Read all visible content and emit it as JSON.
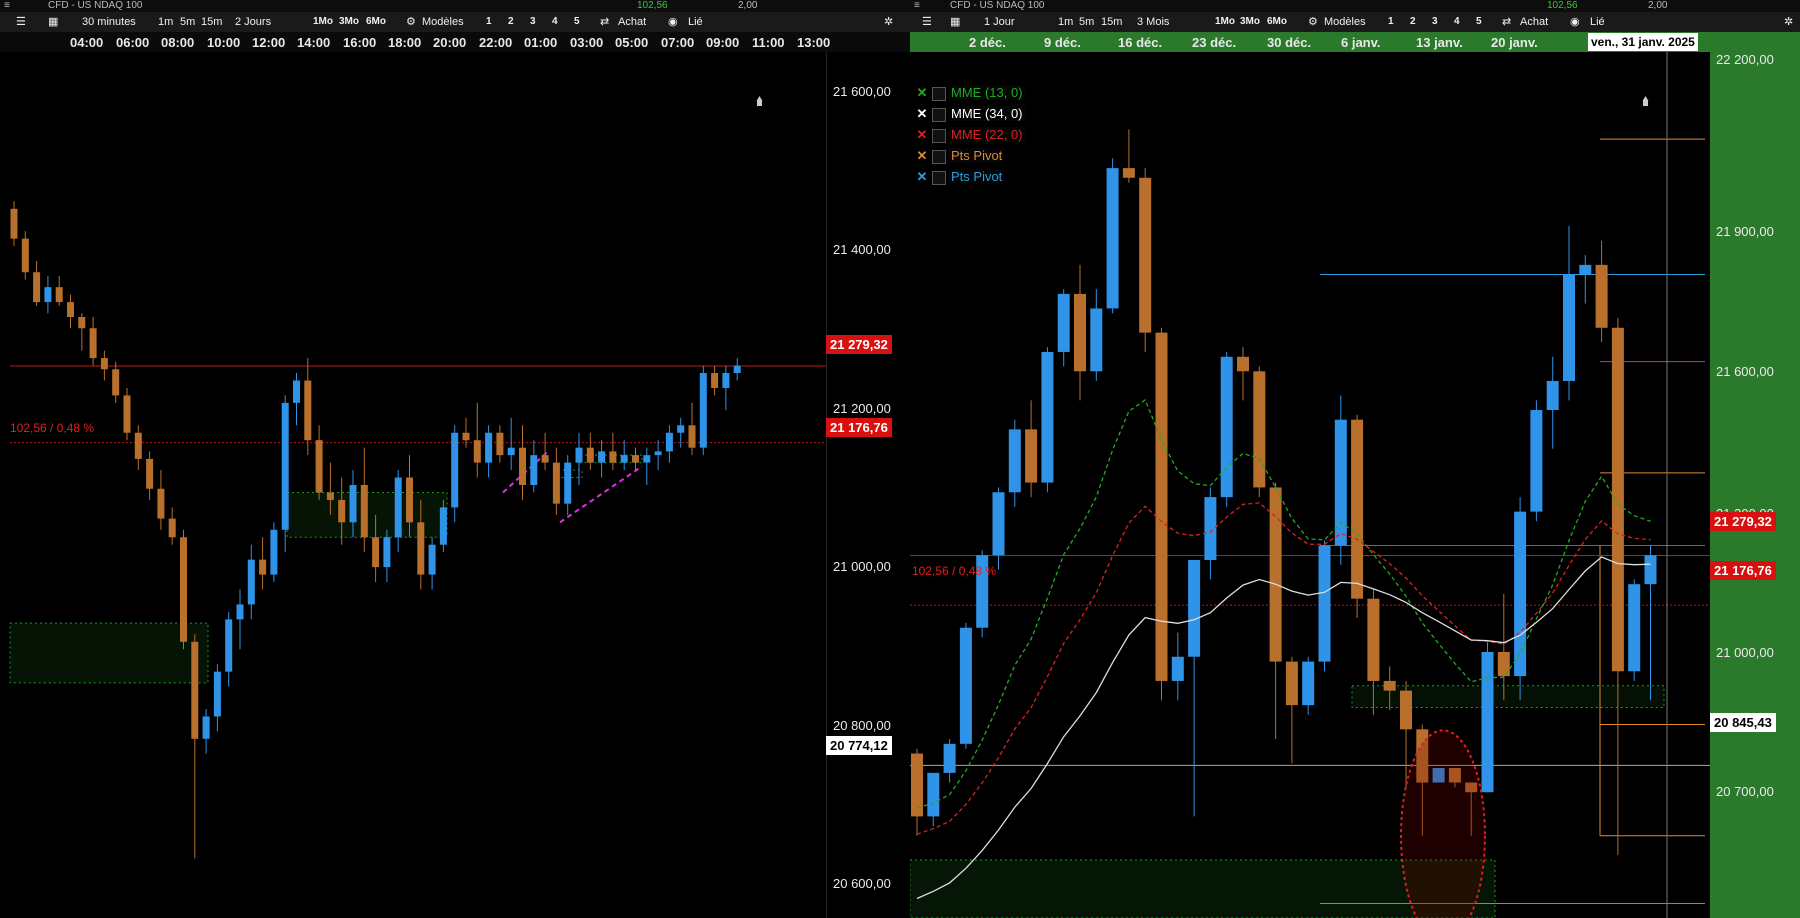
{
  "left": {
    "header": {
      "instrument": "CFD - US NDAQ 100",
      "val1": "102,56",
      "val2": "2,00"
    },
    "toolbar": {
      "interval": "30 minutes",
      "range": "2 Jours",
      "quick": [
        "1m",
        "5m",
        "15m"
      ],
      "periods": [
        "1Mo",
        "3Mo",
        "6Mo"
      ],
      "models": "Modèles",
      "nums": [
        "1",
        "2",
        "3",
        "4",
        "5"
      ],
      "buy": "Achat",
      "linked": "Lié"
    },
    "time_ticks": [
      "04:00",
      "06:00",
      "08:00",
      "10:00",
      "12:00",
      "14:00",
      "16:00",
      "18:00",
      "20:00",
      "22:00",
      "01:00",
      "03:00",
      "05:00",
      "07:00",
      "09:00",
      "11:00",
      "13:00"
    ],
    "price_axis": [
      "21 600,00",
      "21 400,00",
      "21 200,00",
      "21 000,00",
      "20 800,00",
      "20 600,00"
    ],
    "tag_last": "21 279,32",
    "tag_ref": "21 176,76",
    "tag_low": "20 774,12",
    "change_label": "102,56 / 0,48 %"
  },
  "right": {
    "header": {
      "instrument": "CFD - US NDAQ 100",
      "val1": "102,56",
      "val2": "2,00"
    },
    "toolbar": {
      "interval": "1 Jour",
      "range": "3 Mois",
      "quick": [
        "1m",
        "5m",
        "15m"
      ],
      "periods": [
        "1Mo",
        "3Mo",
        "6Mo"
      ],
      "models": "Modèles",
      "nums": [
        "1",
        "2",
        "3",
        "4",
        "5"
      ],
      "buy": "Achat",
      "linked": "Lié"
    },
    "time_ticks": [
      "2 déc.",
      "9 déc.",
      "16 déc.",
      "23 déc.",
      "30 déc.",
      "6 janv.",
      "13 janv.",
      "20 janv."
    ],
    "cursor_date": "ven., 31 janv. 2025",
    "price_axis": [
      "22 200,00",
      "21 900,00",
      "21 600,00",
      "21 300,00",
      "21 000,00",
      "20 700,00"
    ],
    "tag_last": "21 279,32",
    "tag_ref": "21 176,76",
    "tag_cursor": "20 845,43",
    "change_label": "102,56 / 0,48 %",
    "legend": [
      {
        "name": "MME (13, 0)",
        "color": "#22aa22"
      },
      {
        "name": "MME (34, 0)",
        "color": "#ffffff"
      },
      {
        "name": "MME (22, 0)",
        "color": "#e02020"
      },
      {
        "name": "Pts Pivot",
        "color": "#e08a30"
      },
      {
        "name": "Pts Pivot",
        "color": "#2aa0e0"
      }
    ]
  },
  "colors": {
    "up": "#2f93e8",
    "down": "#b8702c",
    "ref_line": "#e02020",
    "green_zone": "#1f9a1f",
    "pink": "#e030e0"
  },
  "chart_data": [
    {
      "type": "candlestick",
      "title": "",
      "interval": "30 minutes",
      "ylim": [
        20540,
        21700
      ],
      "reference_lines": {
        "last": 21279.32,
        "previous_close": 21176.76,
        "low_marker": 20774.12
      },
      "candles": [
        [
          21490,
          21500,
          21440,
          21450
        ],
        [
          21450,
          21460,
          21395,
          21405
        ],
        [
          21405,
          21420,
          21360,
          21365
        ],
        [
          21365,
          21400,
          21350,
          21385
        ],
        [
          21385,
          21400,
          21360,
          21365
        ],
        [
          21365,
          21375,
          21330,
          21345
        ],
        [
          21345,
          21350,
          21300,
          21330
        ],
        [
          21330,
          21345,
          21280,
          21290
        ],
        [
          21290,
          21300,
          21260,
          21275
        ],
        [
          21275,
          21285,
          21230,
          21240
        ],
        [
          21240,
          21250,
          21180,
          21190
        ],
        [
          21190,
          21200,
          21140,
          21155
        ],
        [
          21155,
          21165,
          21100,
          21115
        ],
        [
          21115,
          21140,
          21060,
          21075
        ],
        [
          21075,
          21090,
          21040,
          21050
        ],
        [
          21050,
          21060,
          20900,
          20910
        ],
        [
          20910,
          20920,
          20620,
          20780
        ],
        [
          20780,
          20820,
          20760,
          20810
        ],
        [
          20810,
          20880,
          20790,
          20870
        ],
        [
          20870,
          20950,
          20850,
          20940
        ],
        [
          20940,
          20980,
          20900,
          20960
        ],
        [
          20960,
          21040,
          20940,
          21020
        ],
        [
          21020,
          21050,
          20980,
          21000
        ],
        [
          21000,
          21070,
          20990,
          21060
        ],
        [
          21060,
          21240,
          21030,
          21230
        ],
        [
          21230,
          21270,
          21200,
          21260
        ],
        [
          21260,
          21290,
          21160,
          21180
        ],
        [
          21180,
          21200,
          21100,
          21110
        ],
        [
          21110,
          21150,
          21080,
          21100
        ],
        [
          21100,
          21130,
          21040,
          21070
        ],
        [
          21070,
          21140,
          21050,
          21120
        ],
        [
          21120,
          21170,
          21030,
          21050
        ],
        [
          21050,
          21080,
          20990,
          21010
        ],
        [
          21010,
          21060,
          20990,
          21050
        ],
        [
          21050,
          21140,
          21030,
          21130
        ],
        [
          21130,
          21160,
          21050,
          21070
        ],
        [
          21070,
          21100,
          20980,
          21000
        ],
        [
          21000,
          21050,
          20980,
          21040
        ],
        [
          21040,
          21100,
          21030,
          21090
        ],
        [
          21090,
          21200,
          21070,
          21190
        ],
        [
          21190,
          21210,
          21170,
          21180
        ],
        [
          21180,
          21230,
          21130,
          21150
        ],
        [
          21150,
          21200,
          21130,
          21190
        ],
        [
          21190,
          21200,
          21150,
          21160
        ],
        [
          21160,
          21210,
          21140,
          21170
        ],
        [
          21170,
          21200,
          21100,
          21120
        ],
        [
          21120,
          21180,
          21110,
          21160
        ],
        [
          21160,
          21190,
          21140,
          21150
        ],
        [
          21150,
          21170,
          21080,
          21095
        ],
        [
          21095,
          21160,
          21080,
          21150
        ],
        [
          21150,
          21190,
          21120,
          21170
        ],
        [
          21170,
          21190,
          21140,
          21150
        ],
        [
          21150,
          21180,
          21130,
          21165
        ],
        [
          21165,
          21190,
          21140,
          21150
        ],
        [
          21150,
          21180,
          21140,
          21160
        ],
        [
          21160,
          21170,
          21140,
          21150
        ],
        [
          21150,
          21170,
          21120,
          21160
        ],
        [
          21160,
          21180,
          21140,
          21165
        ],
        [
          21165,
          21200,
          21150,
          21190
        ],
        [
          21190,
          21210,
          21170,
          21200
        ],
        [
          21200,
          21230,
          21160,
          21170
        ],
        [
          21170,
          21280,
          21160,
          21270
        ],
        [
          21270,
          21280,
          21240,
          21250
        ],
        [
          21250,
          21280,
          21220,
          21270
        ],
        [
          21270,
          21290,
          21260,
          21280
        ]
      ]
    },
    {
      "type": "candlestick",
      "title": "",
      "interval": "1 Jour",
      "ylim": [
        20530,
        22320
      ],
      "reference_lines": {
        "last": 21279.32,
        "previous_close": 21176.76,
        "cursor": 20845.43
      },
      "candles": [
        [
          20870,
          20880,
          20700,
          20740
        ],
        [
          20740,
          20830,
          20720,
          20830
        ],
        [
          20830,
          20900,
          20810,
          20890
        ],
        [
          20890,
          21140,
          20880,
          21130
        ],
        [
          21130,
          21290,
          21110,
          21280
        ],
        [
          21280,
          21420,
          21250,
          21410
        ],
        [
          21410,
          21560,
          21380,
          21540
        ],
        [
          21540,
          21600,
          21400,
          21430
        ],
        [
          21430,
          21710,
          21410,
          21700
        ],
        [
          21700,
          21830,
          21670,
          21820
        ],
        [
          21820,
          21880,
          21600,
          21660
        ],
        [
          21660,
          21830,
          21640,
          21790
        ],
        [
          21790,
          22100,
          21780,
          22080
        ],
        [
          22080,
          22160,
          22050,
          22060
        ],
        [
          22060,
          22080,
          21700,
          21740
        ],
        [
          21740,
          21750,
          20980,
          21020
        ],
        [
          21020,
          21120,
          20980,
          21070
        ],
        [
          21070,
          21070,
          20740,
          21270
        ],
        [
          21270,
          21420,
          21230,
          21400
        ],
        [
          21400,
          21700,
          21380,
          21690
        ],
        [
          21690,
          21710,
          21600,
          21660
        ],
        [
          21660,
          21670,
          21400,
          21420
        ],
        [
          21420,
          21430,
          20900,
          21060
        ],
        [
          21060,
          21070,
          20850,
          20970
        ],
        [
          20970,
          21070,
          20950,
          21060
        ],
        [
          21060,
          21310,
          21040,
          21300
        ],
        [
          21300,
          21610,
          21260,
          21560
        ],
        [
          21560,
          21570,
          21150,
          21190
        ],
        [
          21190,
          21210,
          20950,
          21020
        ],
        [
          21020,
          21050,
          20960,
          21000
        ],
        [
          21000,
          21020,
          20800,
          20920
        ],
        [
          20920,
          20930,
          20700,
          20810
        ],
        [
          20810,
          20840,
          20810,
          20840
        ],
        [
          20840,
          20840,
          20800,
          20810
        ],
        [
          20810,
          20810,
          20700,
          20790
        ],
        [
          20790,
          21100,
          20790,
          21080
        ],
        [
          21080,
          21200,
          20980,
          21030
        ],
        [
          21030,
          21400,
          20980,
          21370
        ],
        [
          21370,
          21600,
          21350,
          21580
        ],
        [
          21580,
          21690,
          21500,
          21640
        ],
        [
          21640,
          21960,
          21600,
          21860
        ],
        [
          21860,
          21900,
          21800,
          21880
        ],
        [
          21880,
          21930,
          21720,
          21750
        ],
        [
          21750,
          21770,
          20660,
          21040
        ],
        [
          21040,
          21230,
          21020,
          21220
        ],
        [
          21220,
          21300,
          20980,
          21280
        ]
      ]
    }
  ]
}
